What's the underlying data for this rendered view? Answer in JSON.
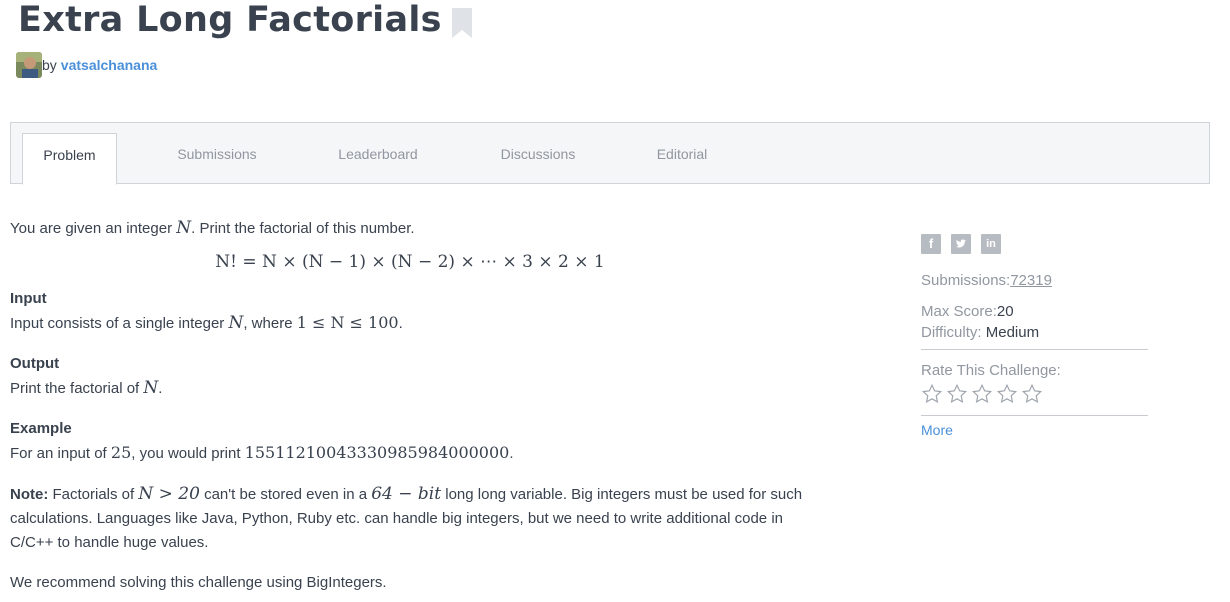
{
  "challenge": {
    "title": "Extra Long Factorials",
    "by_label": "by",
    "author": "vatsalchanana"
  },
  "tabs": [
    {
      "label": "Problem",
      "active": true
    },
    {
      "label": "Submissions",
      "active": false
    },
    {
      "label": "Leaderboard",
      "active": false
    },
    {
      "label": "Discussions",
      "active": false
    },
    {
      "label": "Editorial",
      "active": false
    }
  ],
  "problem": {
    "intro_a": "You are given an integer ",
    "intro_var": "N",
    "intro_b": ". Print the factorial of this number.",
    "formula": "N! = N × (N − 1) × (N − 2) × ⋯ × 3 × 2 × 1",
    "input_title": "Input",
    "input_a": "Input consists of a single integer ",
    "input_var": "N",
    "input_b": ", where ",
    "input_range": "1 ≤ N ≤ 100",
    "input_c": ".",
    "output_title": "Output",
    "output_a": "Print the factorial of ",
    "output_var": "N",
    "output_b": ".",
    "example_title": "Example",
    "example_a": "For an input of ",
    "example_input": "25",
    "example_b": ", you would print ",
    "example_output": "15511210043330985984000000",
    "example_c": ".",
    "note_label": "Note:",
    "note_a": " Factorials of ",
    "note_cond": "N > 20",
    "note_b": " can't be stored even in a ",
    "note_bits": "64 − bit",
    "note_c": " long long variable. Big integers must be used for such calculations. Languages like Java, Python, Ruby etc. can handle big integers, but we need to write additional code in C/C++ to handle huge values.",
    "recommend": "We recommend solving this challenge using BigIntegers."
  },
  "sidebar": {
    "social_icons": [
      "facebook-icon",
      "twitter-icon",
      "linkedin-icon"
    ],
    "submissions_label": "Submissions:",
    "submissions_value": "72319",
    "max_score_label": "Max Score:",
    "max_score_value": "20",
    "difficulty_label": "Difficulty:",
    "difficulty_value": "Medium",
    "rate_label": "Rate This Challenge:",
    "more_label": "More"
  },
  "colors": {
    "link": "#4a90d9",
    "text": "#39424e",
    "muted": "#9197a0"
  }
}
